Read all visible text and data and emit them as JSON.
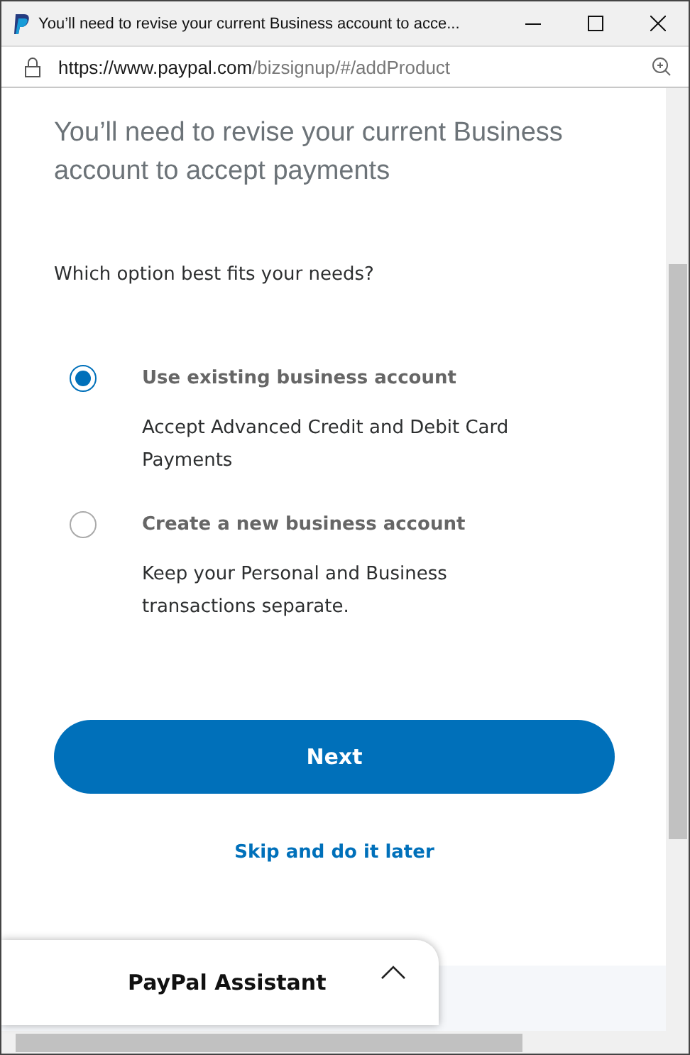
{
  "window": {
    "title": "You’ll need to revise your current Business account to acce..."
  },
  "address_bar": {
    "url_host": "https://www.paypal.com",
    "url_path": "/bizsignup/#/addProduct"
  },
  "heading": "You’ll need to revise your current Business account to accept payments",
  "question": "Which option best fits your needs?",
  "options": [
    {
      "label": "Use existing business account",
      "description": "Accept Advanced Credit and Debit Card Payments",
      "selected": true
    },
    {
      "label": "Create a new business account",
      "description": "Keep your Personal and Business transactions separate.",
      "selected": false
    }
  ],
  "next_button": "Next",
  "skip_link": "Skip and do it later",
  "assistant": {
    "title": "PayPal Assistant",
    "expanded": false
  }
}
